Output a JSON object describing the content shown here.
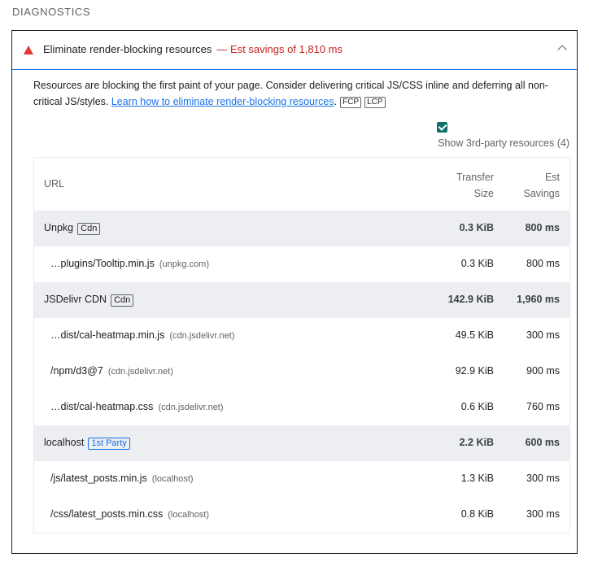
{
  "section": {
    "title": "DIAGNOSTICS"
  },
  "audit": {
    "title": "Eliminate render-blocking resources",
    "savings": "— Est savings of 1,810 ms",
    "description_text": "Resources are blocking the first paint of your page. Consider delivering critical JS/CSS inline and deferring all non-critical JS/styles. ",
    "learn_link": "Learn how to eliminate render-blocking resources",
    "description_end": ".",
    "metric_tags": [
      "FCP",
      "LCP"
    ],
    "third_party_toggle": {
      "checked": true,
      "label": "Show 3rd-party resources (4)"
    }
  },
  "table": {
    "headers": {
      "url": "URL",
      "size_line1": "Transfer",
      "size_line2": "Size",
      "savings_line1": "Est",
      "savings_line2": "Savings"
    },
    "groups": [
      {
        "name": "Unpkg",
        "tag": "Cdn",
        "size": "0.3 KiB",
        "savings": "800 ms",
        "items": [
          {
            "url": "…plugins/Tooltip.min.js",
            "host": "(unpkg.com)",
            "size": "0.3 KiB",
            "savings": "800 ms"
          }
        ]
      },
      {
        "name": "JSDelivr CDN",
        "tag": "Cdn",
        "size": "142.9 KiB",
        "savings": "1,960 ms",
        "items": [
          {
            "url": "…dist/cal-heatmap.min.js",
            "host": "(cdn.jsdelivr.net)",
            "size": "49.5 KiB",
            "savings": "300 ms"
          },
          {
            "url": "/npm/d3@7",
            "host": "(cdn.jsdelivr.net)",
            "size": "92.9 KiB",
            "savings": "900 ms"
          },
          {
            "url": "…dist/cal-heatmap.css",
            "host": "(cdn.jsdelivr.net)",
            "size": "0.6 KiB",
            "savings": "760 ms"
          }
        ]
      },
      {
        "name": "localhost",
        "tag": "1st Party",
        "size": "2.2 KiB",
        "savings": "600 ms",
        "items": [
          {
            "url": "/js/latest_posts.min.js",
            "host": "(localhost)",
            "size": "1.3 KiB",
            "savings": "300 ms"
          },
          {
            "url": "/css/latest_posts.min.css",
            "host": "(localhost)",
            "size": "0.8 KiB",
            "savings": "300 ms"
          }
        ]
      }
    ]
  },
  "colors": {
    "fail": "#e53935",
    "savings": "#c5221f",
    "link": "#1a73e8",
    "checkbox": "#12706b",
    "group_bg": "#eceef1"
  },
  "icons": {
    "fail": "triangle-fail-icon",
    "collapse": "chevron-up-icon"
  }
}
